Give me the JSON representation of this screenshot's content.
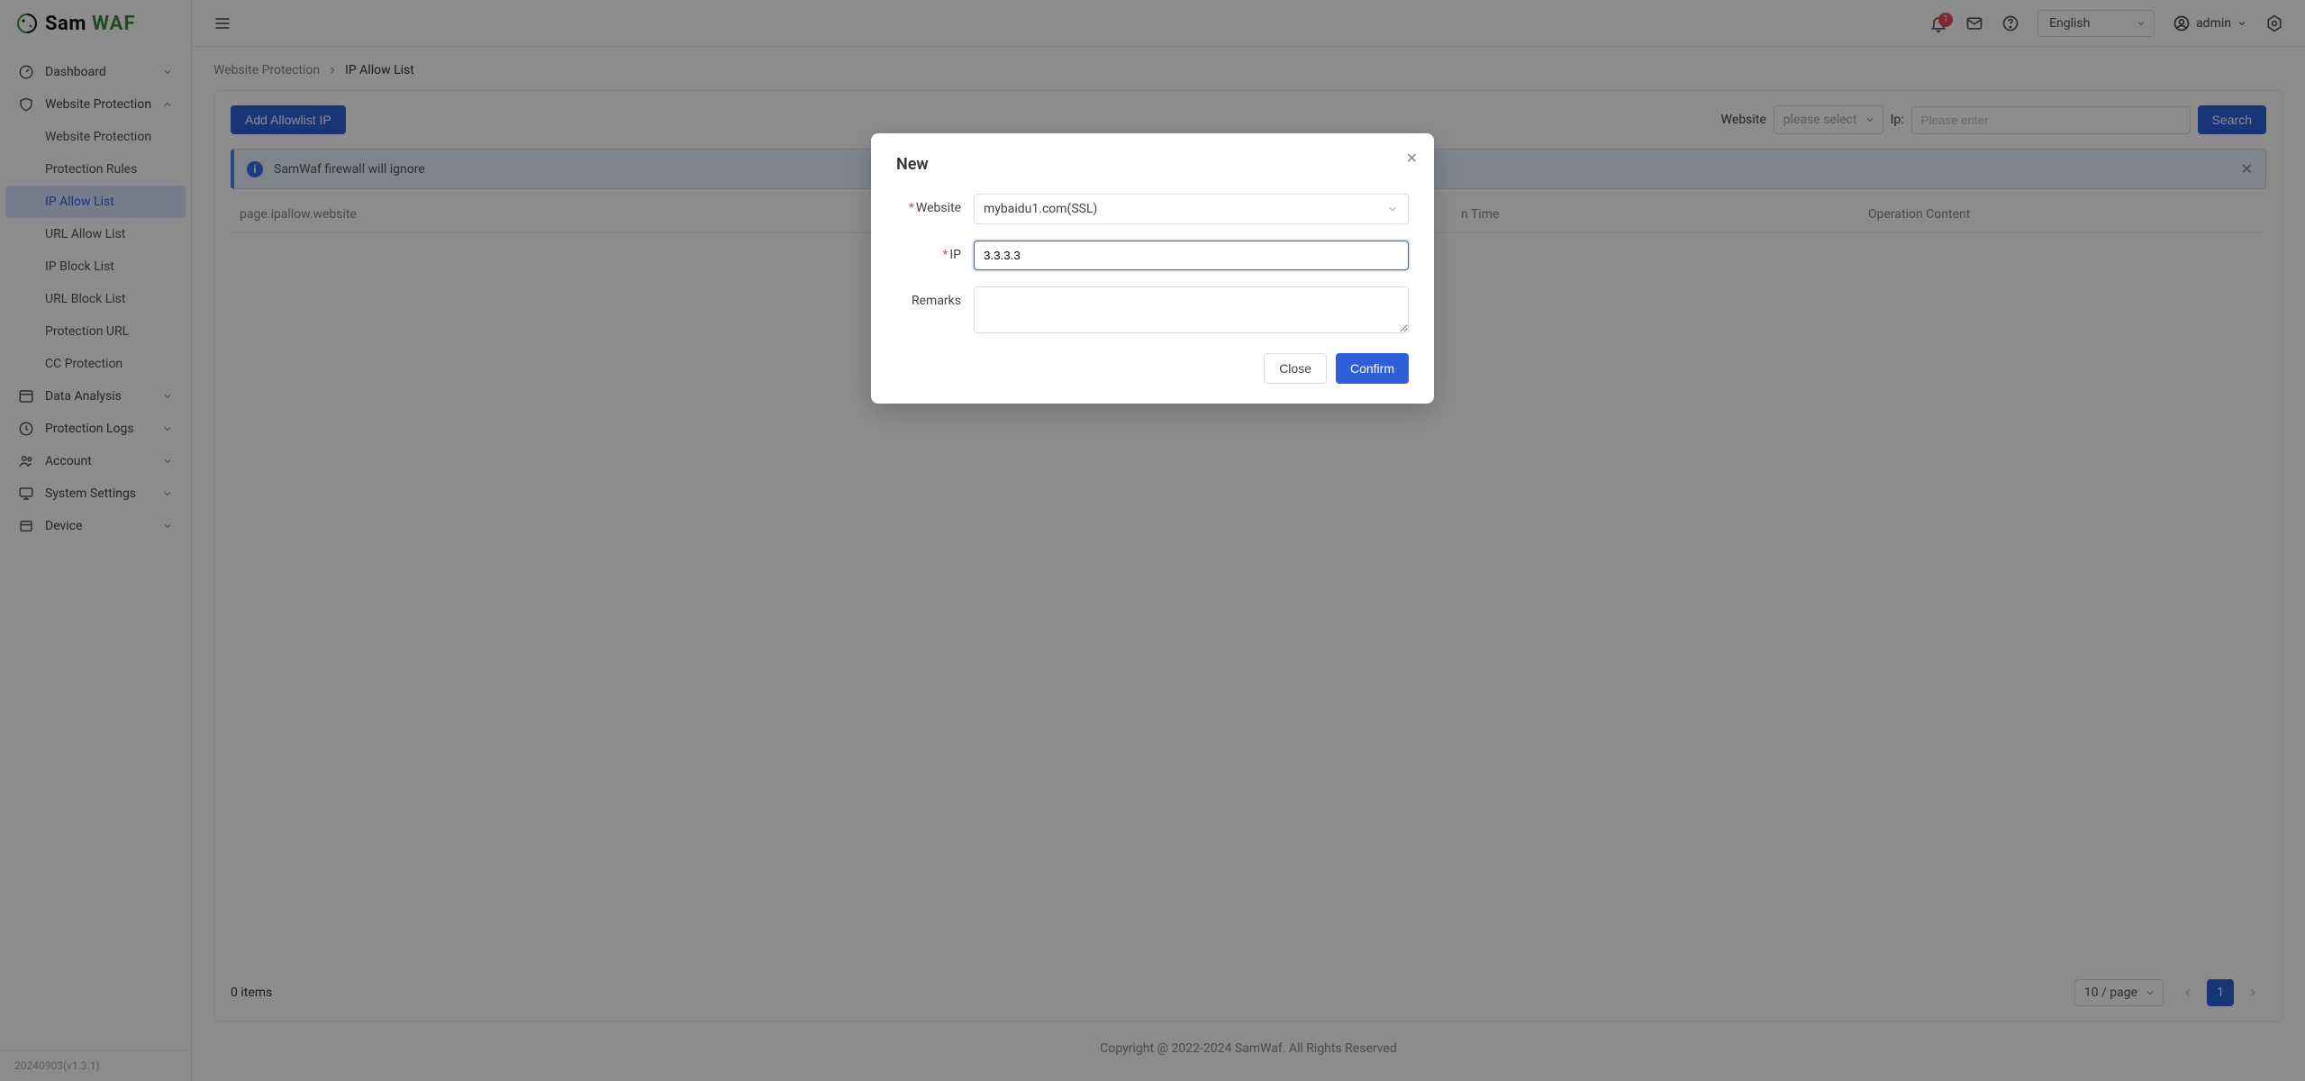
{
  "brand": {
    "name1": "Sam",
    "name2": "WAF"
  },
  "sidebar": {
    "items": [
      {
        "label": "Dashboard",
        "icon": "dashboard"
      },
      {
        "label": "Website Protection",
        "icon": "shield",
        "expanded": true,
        "children": [
          {
            "label": "Website Protection"
          },
          {
            "label": "Protection Rules"
          },
          {
            "label": "IP Allow List",
            "active": true
          },
          {
            "label": "URL Allow List"
          },
          {
            "label": "IP Block List"
          },
          {
            "label": "URL Block List"
          },
          {
            "label": "Protection URL"
          },
          {
            "label": "CC Protection"
          }
        ]
      },
      {
        "label": "Data Analysis",
        "icon": "data"
      },
      {
        "label": "Protection Logs",
        "icon": "clock"
      },
      {
        "label": "Account",
        "icon": "users"
      },
      {
        "label": "System Settings",
        "icon": "monitor"
      },
      {
        "label": "Device",
        "icon": "device"
      }
    ],
    "version": "20240903(v1.3.1)"
  },
  "topbar": {
    "notification_count": "1",
    "language": "English",
    "user": "admin"
  },
  "breadcrumb": {
    "parent": "Website Protection",
    "current": "IP Allow List"
  },
  "page": {
    "add_button": "Add Allowlist IP",
    "filter_website_label": "Website",
    "filter_website_placeholder": "please select",
    "filter_ip_label": "Ip:",
    "filter_ip_placeholder": "Please enter",
    "search_button": "Search",
    "alert_text": "SamWaf firewall will ignore",
    "columns": [
      "page.ipallow.website",
      "",
      "",
      "n Time",
      "Operation Content"
    ],
    "items_text": "0 items",
    "page_size": "10 / page",
    "current_page": "1"
  },
  "modal": {
    "title": "New",
    "website_label": "Website",
    "website_value": "mybaidu1.com(SSL)",
    "ip_label": "IP",
    "ip_value": "3.3.3.3",
    "remarks_label": "Remarks",
    "remarks_value": "",
    "close_button": "Close",
    "confirm_button": "Confirm"
  },
  "footer": "Copyright @ 2022-2024 SamWaf. All Rights Reserved"
}
